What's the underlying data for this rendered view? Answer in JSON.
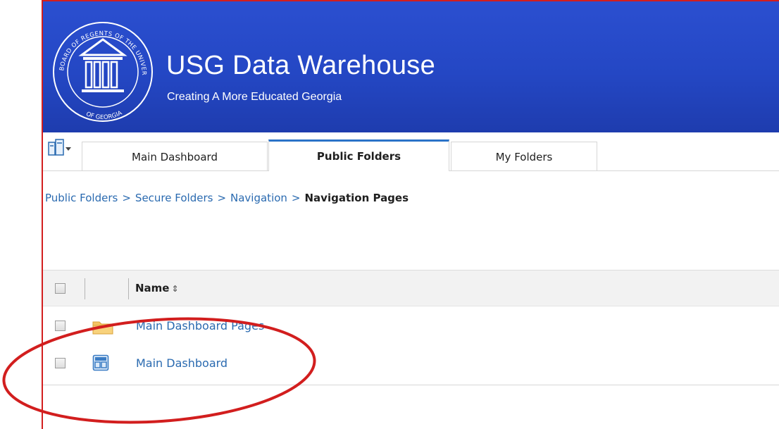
{
  "banner": {
    "title": "USG Data Warehouse",
    "subtitle": "Creating A More Educated Georgia",
    "background_color": "#2447c4",
    "seal": {
      "top_text": "BOARD OF REGENTS OF THE UNIVERSITY SYSTEM",
      "bottom_text": "OF GEORGIA"
    }
  },
  "tabs": [
    {
      "label": "Main Dashboard",
      "active": false
    },
    {
      "label": "Public Folders",
      "active": true
    },
    {
      "label": "My Folders",
      "active": false
    }
  ],
  "breadcrumb": {
    "items": [
      "Public Folders",
      "Secure Folders",
      "Navigation"
    ],
    "separator": ">",
    "current": "Navigation Pages"
  },
  "list": {
    "header": {
      "name_label": "Name",
      "sort_icon": "sort-updown-icon"
    },
    "rows": [
      {
        "name": "Main Dashboard Pages",
        "icon": "folder-icon"
      },
      {
        "name": "Main Dashboard",
        "icon": "dashboard-icon"
      }
    ]
  },
  "colors": {
    "accent": "#2a73c8",
    "link": "#2a6ab0",
    "annotation": "#d21e1e"
  }
}
